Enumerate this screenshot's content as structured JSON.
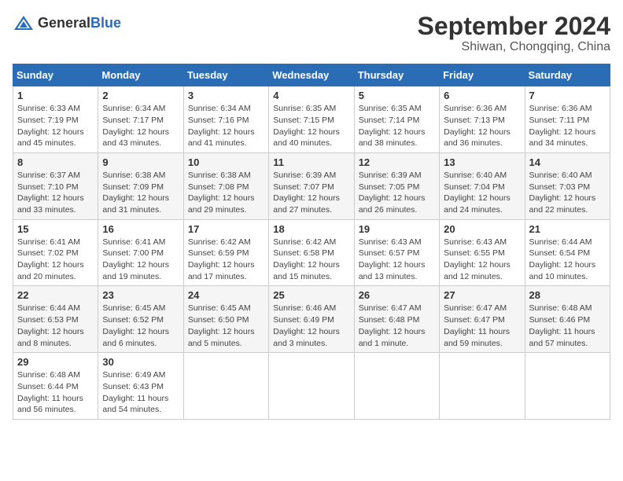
{
  "logo": {
    "general": "General",
    "blue": "Blue"
  },
  "title": "September 2024",
  "subtitle": "Shiwan, Chongqing, China",
  "days_of_week": [
    "Sunday",
    "Monday",
    "Tuesday",
    "Wednesday",
    "Thursday",
    "Friday",
    "Saturday"
  ],
  "weeks": [
    [
      {
        "day": "1",
        "info": "Sunrise: 6:33 AM\nSunset: 7:19 PM\nDaylight: 12 hours\nand 45 minutes."
      },
      {
        "day": "2",
        "info": "Sunrise: 6:34 AM\nSunset: 7:17 PM\nDaylight: 12 hours\nand 43 minutes."
      },
      {
        "day": "3",
        "info": "Sunrise: 6:34 AM\nSunset: 7:16 PM\nDaylight: 12 hours\nand 41 minutes."
      },
      {
        "day": "4",
        "info": "Sunrise: 6:35 AM\nSunset: 7:15 PM\nDaylight: 12 hours\nand 40 minutes."
      },
      {
        "day": "5",
        "info": "Sunrise: 6:35 AM\nSunset: 7:14 PM\nDaylight: 12 hours\nand 38 minutes."
      },
      {
        "day": "6",
        "info": "Sunrise: 6:36 AM\nSunset: 7:13 PM\nDaylight: 12 hours\nand 36 minutes."
      },
      {
        "day": "7",
        "info": "Sunrise: 6:36 AM\nSunset: 7:11 PM\nDaylight: 12 hours\nand 34 minutes."
      }
    ],
    [
      {
        "day": "8",
        "info": "Sunrise: 6:37 AM\nSunset: 7:10 PM\nDaylight: 12 hours\nand 33 minutes."
      },
      {
        "day": "9",
        "info": "Sunrise: 6:38 AM\nSunset: 7:09 PM\nDaylight: 12 hours\nand 31 minutes."
      },
      {
        "day": "10",
        "info": "Sunrise: 6:38 AM\nSunset: 7:08 PM\nDaylight: 12 hours\nand 29 minutes."
      },
      {
        "day": "11",
        "info": "Sunrise: 6:39 AM\nSunset: 7:07 PM\nDaylight: 12 hours\nand 27 minutes."
      },
      {
        "day": "12",
        "info": "Sunrise: 6:39 AM\nSunset: 7:05 PM\nDaylight: 12 hours\nand 26 minutes."
      },
      {
        "day": "13",
        "info": "Sunrise: 6:40 AM\nSunset: 7:04 PM\nDaylight: 12 hours\nand 24 minutes."
      },
      {
        "day": "14",
        "info": "Sunrise: 6:40 AM\nSunset: 7:03 PM\nDaylight: 12 hours\nand 22 minutes."
      }
    ],
    [
      {
        "day": "15",
        "info": "Sunrise: 6:41 AM\nSunset: 7:02 PM\nDaylight: 12 hours\nand 20 minutes."
      },
      {
        "day": "16",
        "info": "Sunrise: 6:41 AM\nSunset: 7:00 PM\nDaylight: 12 hours\nand 19 minutes."
      },
      {
        "day": "17",
        "info": "Sunrise: 6:42 AM\nSunset: 6:59 PM\nDaylight: 12 hours\nand 17 minutes."
      },
      {
        "day": "18",
        "info": "Sunrise: 6:42 AM\nSunset: 6:58 PM\nDaylight: 12 hours\nand 15 minutes."
      },
      {
        "day": "19",
        "info": "Sunrise: 6:43 AM\nSunset: 6:57 PM\nDaylight: 12 hours\nand 13 minutes."
      },
      {
        "day": "20",
        "info": "Sunrise: 6:43 AM\nSunset: 6:55 PM\nDaylight: 12 hours\nand 12 minutes."
      },
      {
        "day": "21",
        "info": "Sunrise: 6:44 AM\nSunset: 6:54 PM\nDaylight: 12 hours\nand 10 minutes."
      }
    ],
    [
      {
        "day": "22",
        "info": "Sunrise: 6:44 AM\nSunset: 6:53 PM\nDaylight: 12 hours\nand 8 minutes."
      },
      {
        "day": "23",
        "info": "Sunrise: 6:45 AM\nSunset: 6:52 PM\nDaylight: 12 hours\nand 6 minutes."
      },
      {
        "day": "24",
        "info": "Sunrise: 6:45 AM\nSunset: 6:50 PM\nDaylight: 12 hours\nand 5 minutes."
      },
      {
        "day": "25",
        "info": "Sunrise: 6:46 AM\nSunset: 6:49 PM\nDaylight: 12 hours\nand 3 minutes."
      },
      {
        "day": "26",
        "info": "Sunrise: 6:47 AM\nSunset: 6:48 PM\nDaylight: 12 hours\nand 1 minute."
      },
      {
        "day": "27",
        "info": "Sunrise: 6:47 AM\nSunset: 6:47 PM\nDaylight: 11 hours\nand 59 minutes."
      },
      {
        "day": "28",
        "info": "Sunrise: 6:48 AM\nSunset: 6:46 PM\nDaylight: 11 hours\nand 57 minutes."
      }
    ],
    [
      {
        "day": "29",
        "info": "Sunrise: 6:48 AM\nSunset: 6:44 PM\nDaylight: 11 hours\nand 56 minutes."
      },
      {
        "day": "30",
        "info": "Sunrise: 6:49 AM\nSunset: 6:43 PM\nDaylight: 11 hours\nand 54 minutes."
      },
      {
        "day": "",
        "info": ""
      },
      {
        "day": "",
        "info": ""
      },
      {
        "day": "",
        "info": ""
      },
      {
        "day": "",
        "info": ""
      },
      {
        "day": "",
        "info": ""
      }
    ]
  ]
}
